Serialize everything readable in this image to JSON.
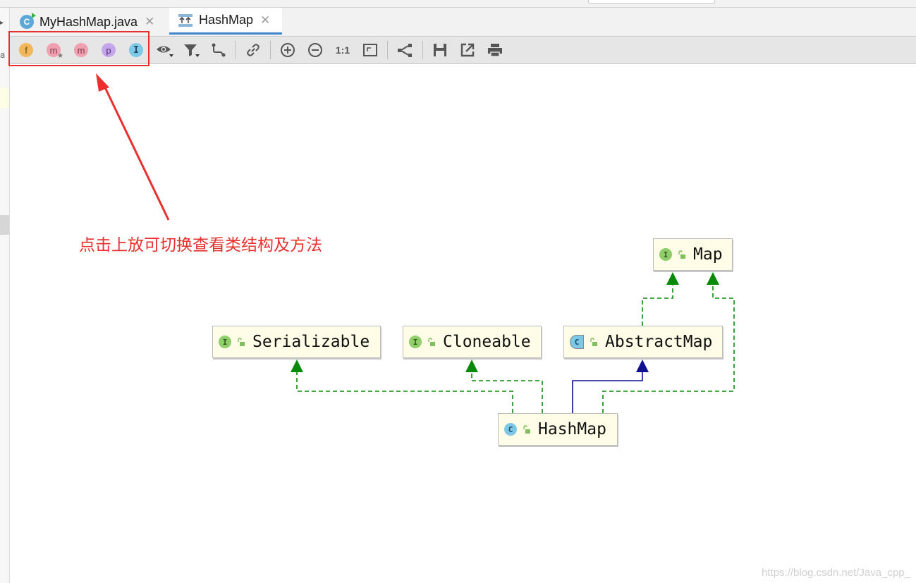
{
  "tabs": [
    {
      "label": "MyHashMap.java",
      "icon": "class-run-icon"
    },
    {
      "label": "HashMap",
      "icon": "diagram-icon",
      "active": true
    }
  ],
  "toolbar": {
    "member_filters": [
      {
        "letter": "f",
        "name": "fields",
        "color": "#f0b85a"
      },
      {
        "letter": "m",
        "name": "constructors",
        "color": "#f0a0b0"
      },
      {
        "letter": "m",
        "name": "methods",
        "color": "#f0a0b0"
      },
      {
        "letter": "p",
        "name": "properties",
        "color": "#c5a6ec"
      },
      {
        "letter": "I",
        "name": "inner-classes",
        "color": "#7cc8e6"
      }
    ],
    "zoom_actual_label": "1:1"
  },
  "annotation": "点击上放可切换查看类结构及方法",
  "diagram": {
    "nodes": [
      {
        "id": "map",
        "label": "Map",
        "kind": "interface",
        "icon_letter": "I"
      },
      {
        "id": "serializable",
        "label": "Serializable",
        "kind": "interface",
        "icon_letter": "I"
      },
      {
        "id": "cloneable",
        "label": "Cloneable",
        "kind": "interface",
        "icon_letter": "I"
      },
      {
        "id": "abstractmap",
        "label": "AbstractMap",
        "kind": "abstract-class",
        "icon_letter": "C"
      },
      {
        "id": "hashmap",
        "label": "HashMap",
        "kind": "class",
        "icon_letter": "C"
      }
    ],
    "edges": [
      {
        "from": "hashmap",
        "to": "serializable",
        "type": "implements"
      },
      {
        "from": "hashmap",
        "to": "cloneable",
        "type": "implements"
      },
      {
        "from": "hashmap",
        "to": "abstractmap",
        "type": "extends"
      },
      {
        "from": "hashmap",
        "to": "map",
        "type": "implements"
      },
      {
        "from": "abstractmap",
        "to": "map",
        "type": "implements"
      }
    ],
    "colors": {
      "implements": "#0a8a0a",
      "extends": "#101090",
      "node_bg": "#fffde7"
    }
  },
  "gutter_char": "a",
  "watermark": "https://blog.csdn.net/Java_cpp_"
}
